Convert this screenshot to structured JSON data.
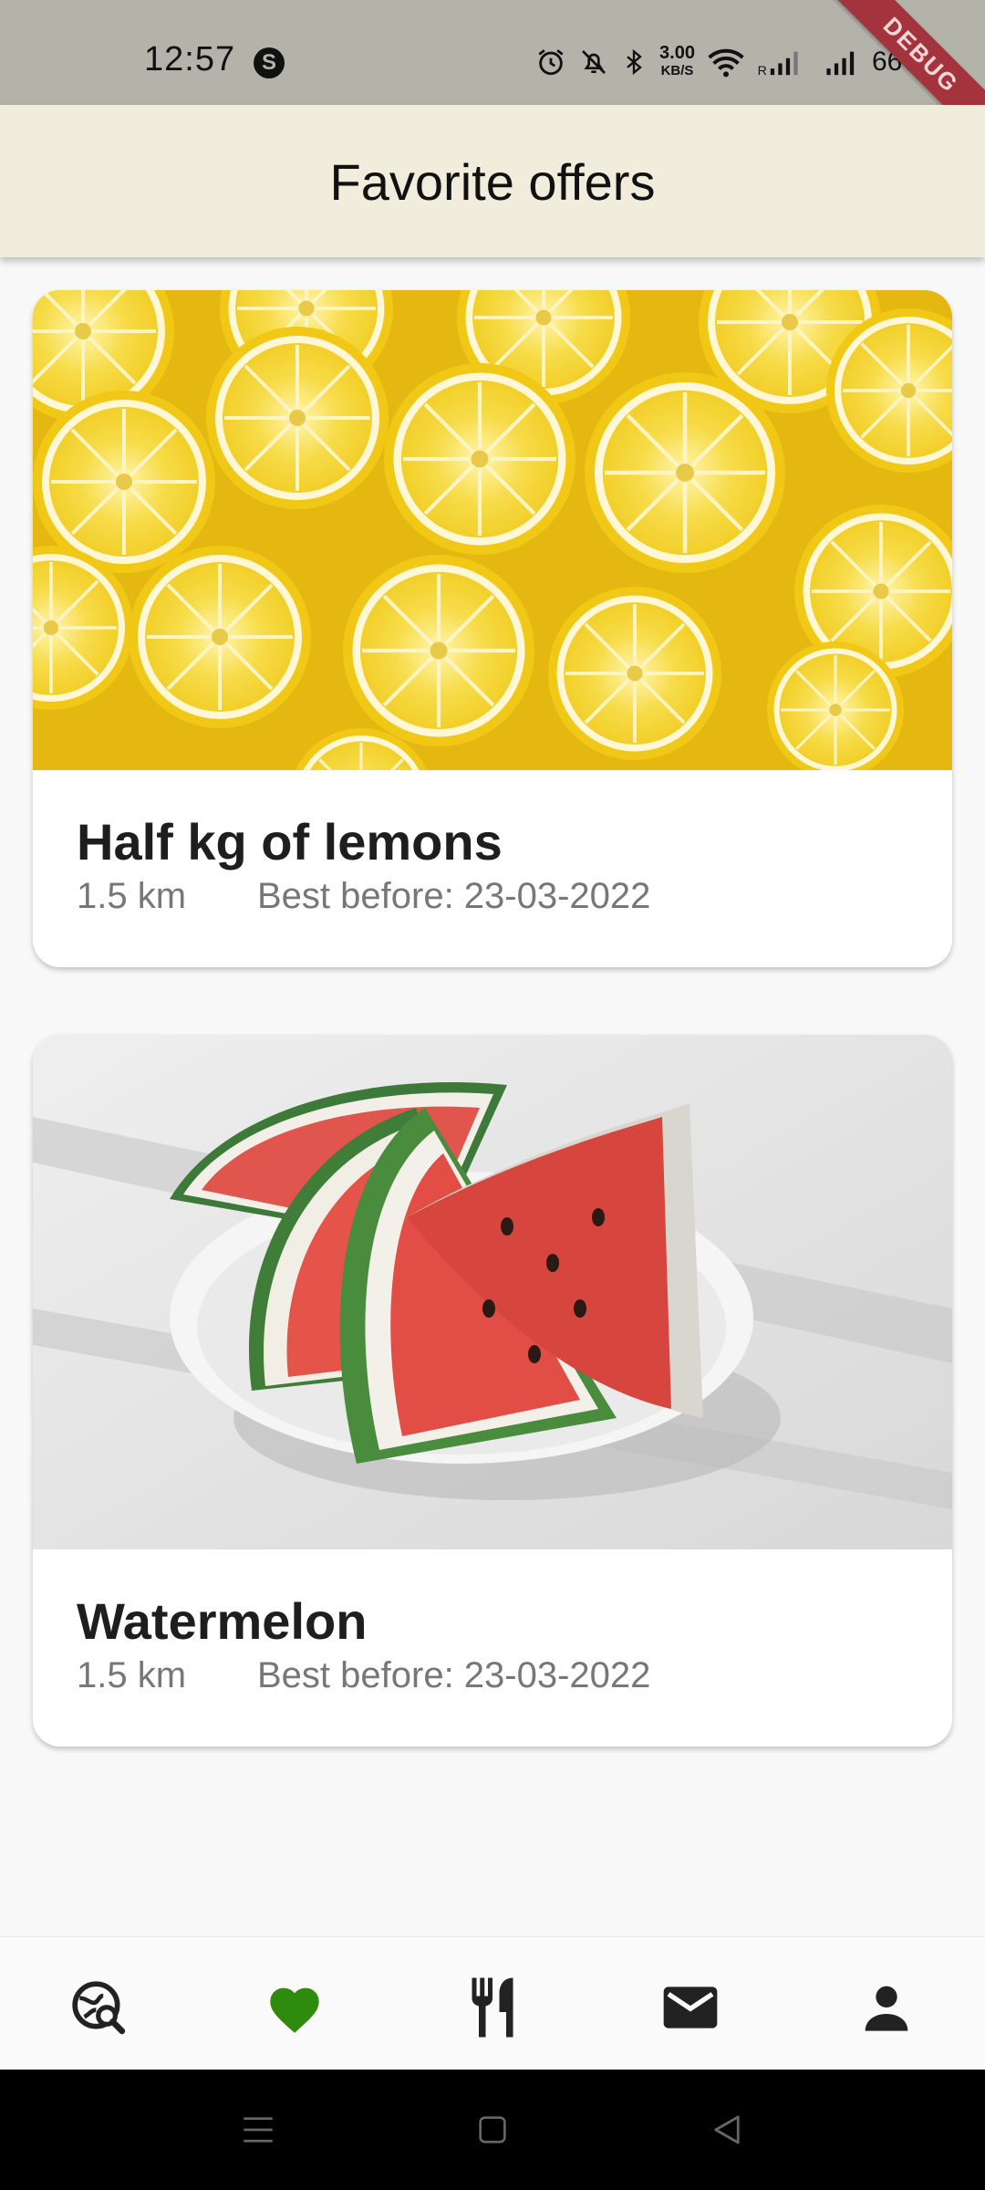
{
  "status_bar": {
    "time": "12:57",
    "app_badge": "S",
    "net_speed_value": "3.00",
    "net_speed_unit": "KB/S",
    "battery": "66%",
    "icons": [
      "alarm-icon",
      "mute-icon",
      "bluetooth-icon",
      "wifi-icon",
      "signal-icon",
      "battery-charging-icon"
    ]
  },
  "debug_banner": "DEBUG",
  "app_bar": {
    "title": "Favorite offers"
  },
  "offers": [
    {
      "title": "Half kg of lemons",
      "distance": "1.5 km",
      "best_before": "Best before: 23-03-2022",
      "image": "lemon-slices-photo"
    },
    {
      "title": "Watermelon",
      "distance": "1.5 km",
      "best_before": "Best before: 23-03-2022",
      "image": "watermelon-slices-photo"
    }
  ],
  "bottom_nav": {
    "items": [
      "search-map-icon",
      "heart-icon",
      "restaurant-icon",
      "mail-icon",
      "person-icon"
    ],
    "active": "heart-icon",
    "active_color": "#2e8b0e",
    "inactive_color": "#222222"
  },
  "colors": {
    "app_bar_bg": "#f0eddc",
    "status_bar_bg": "#b4b3aa",
    "debug_banner": "#a3343e"
  }
}
